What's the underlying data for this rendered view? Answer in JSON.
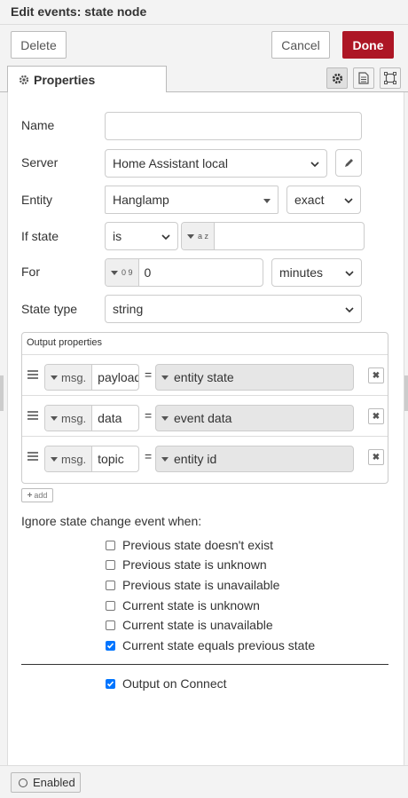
{
  "dialog": {
    "title": "Edit events: state node",
    "delete_label": "Delete",
    "cancel_label": "Cancel",
    "done_label": "Done"
  },
  "tabs": {
    "properties_label": "Properties"
  },
  "form": {
    "name_label": "Name",
    "name_value": "",
    "server_label": "Server",
    "server_value": "Home Assistant local",
    "entity_label": "Entity",
    "entity_value": "Hanglamp",
    "entity_match": "exact",
    "ifstate_label": "If state",
    "ifstate_operator": "is",
    "ifstate_type_glyph": "a z",
    "ifstate_value": "",
    "for_label": "For",
    "for_type_glyph": "0 9",
    "for_value": "0",
    "for_unit": "minutes",
    "statetype_label": "State type",
    "statetype_value": "string"
  },
  "output_properties": {
    "title": "Output properties",
    "rows": [
      {
        "prefix": "msg.",
        "property": "payload",
        "equals": "=",
        "value": "entity state"
      },
      {
        "prefix": "msg.",
        "property": "data",
        "equals": "=",
        "value": "event data"
      },
      {
        "prefix": "msg.",
        "property": "topic",
        "equals": "=",
        "value": "entity id"
      }
    ],
    "add_label": "add",
    "remove_glyph": "✖"
  },
  "ignore": {
    "heading": "Ignore state change event when:",
    "options": [
      {
        "label": "Previous state doesn't exist",
        "checked": false
      },
      {
        "label": "Previous state is unknown",
        "checked": false
      },
      {
        "label": "Previous state is unavailable",
        "checked": false
      },
      {
        "label": "Current state is unknown",
        "checked": false
      },
      {
        "label": "Current state is unavailable",
        "checked": false
      },
      {
        "label": "Current state equals previous state",
        "checked": true
      }
    ]
  },
  "output_on_connect": {
    "label": "Output on Connect",
    "checked": true
  },
  "footer": {
    "enabled_label": "Enabled"
  },
  "colors": {
    "accent": "#ad1625",
    "checkbox": "#0075ff"
  }
}
